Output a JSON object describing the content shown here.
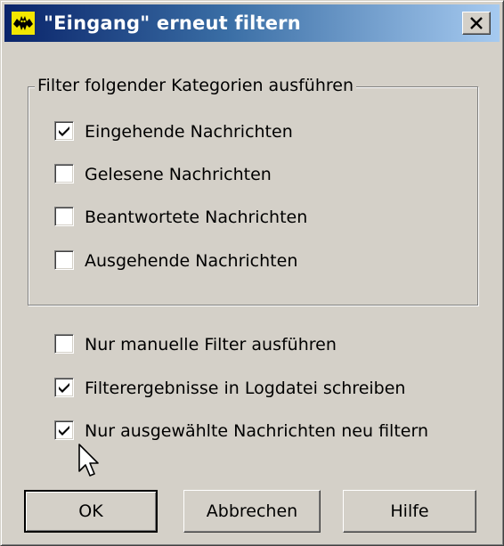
{
  "window": {
    "title": "\"Eingang\" erneut filtern",
    "close_label": "Close"
  },
  "group": {
    "legend": "Filter folgender Kategorien ausführen",
    "items": [
      {
        "label": "Eingehende Nachrichten",
        "checked": true
      },
      {
        "label": "Gelesene Nachrichten",
        "checked": false
      },
      {
        "label": "Beantwortete Nachrichten",
        "checked": false
      },
      {
        "label": "Ausgehende Nachrichten",
        "checked": false
      }
    ]
  },
  "options": [
    {
      "label": "Nur manuelle Filter ausführen",
      "checked": false
    },
    {
      "label": "Filterergebnisse in Logdatei schreiben",
      "checked": true
    },
    {
      "label": "Nur ausgewählte Nachrichten neu filtern",
      "checked": true
    }
  ],
  "buttons": {
    "ok": "OK",
    "cancel": "Abbrechen",
    "help": "Hilfe"
  },
  "icons": {
    "app": "thebat-app-icon",
    "close": "close-icon",
    "check": "checkmark-icon",
    "cursor": "mouse-pointer-icon"
  }
}
